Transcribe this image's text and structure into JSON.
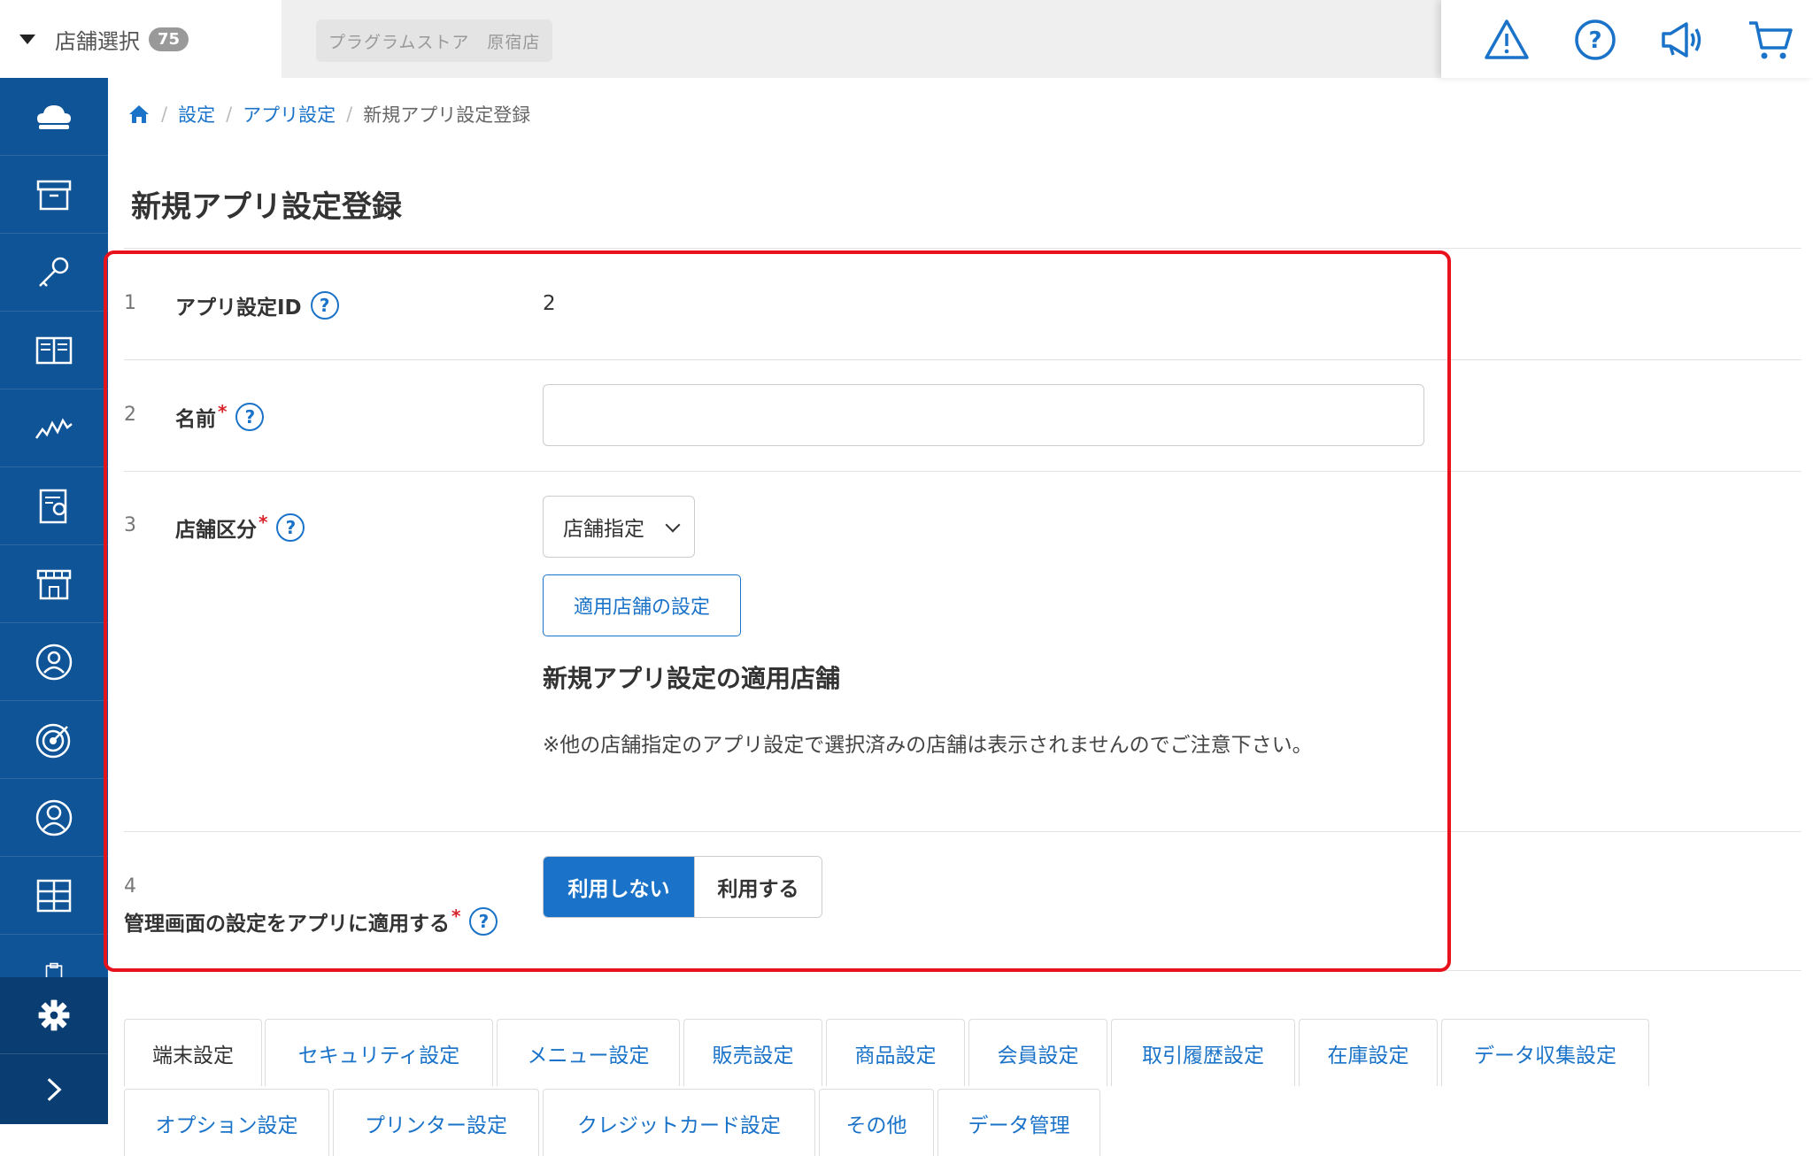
{
  "topbar": {
    "store_select_label": "店舗選択",
    "store_count": "75",
    "store_name": "プラグラムストア　原宿店",
    "icons": [
      "warning-icon",
      "help-icon",
      "announcement-icon",
      "cart-icon"
    ]
  },
  "sidebar": {
    "items": [
      "cloud-icon",
      "archive-icon",
      "key-icon",
      "book-icon",
      "chart-icon",
      "report-icon",
      "store-icon",
      "user-circle-icon",
      "target-icon",
      "member-icon",
      "grid-icon",
      "clipboard-icon"
    ],
    "settings": "gear-icon",
    "expand": "chevron-right-icon"
  },
  "breadcrumb": {
    "home": "home-icon",
    "items": [
      "設定",
      "アプリ設定",
      "新規アプリ設定登録"
    ]
  },
  "page_title": "新規アプリ設定登録",
  "form": {
    "row1": {
      "num": "1",
      "label": "アプリ設定ID",
      "value": "2"
    },
    "row2": {
      "num": "2",
      "label": "名前",
      "required": "*",
      "value": ""
    },
    "row3": {
      "num": "3",
      "label": "店舗区分",
      "required": "*",
      "select_value": "店舗指定",
      "button": "適用店舗の設定",
      "subheading": "新規アプリ設定の適用店舗",
      "note": "※他の店舗指定のアプリ設定で選択済みの店舗は表示されませんのでご注意下さい。"
    },
    "row4": {
      "num": "4",
      "label": "管理画面の設定をアプリに適用する",
      "required": "*",
      "options": [
        "利用しない",
        "利用する"
      ],
      "selected": "利用しない"
    },
    "help_symbol": "?"
  },
  "tabs": {
    "row1": [
      "端末設定",
      "セキュリティ設定",
      "メニュー設定",
      "販売設定",
      "商品設定",
      "会員設定",
      "取引履歴設定",
      "在庫設定",
      "データ収集設定"
    ],
    "row2": [
      "オプション設定",
      "プリンター設定",
      "クレジットカード設定",
      "その他",
      "データ管理"
    ],
    "active": "端末設定"
  },
  "colors": {
    "sidebar": "#0f5497",
    "accent": "#1a73c8",
    "highlight": "#e8121c",
    "required": "#d8232a"
  }
}
